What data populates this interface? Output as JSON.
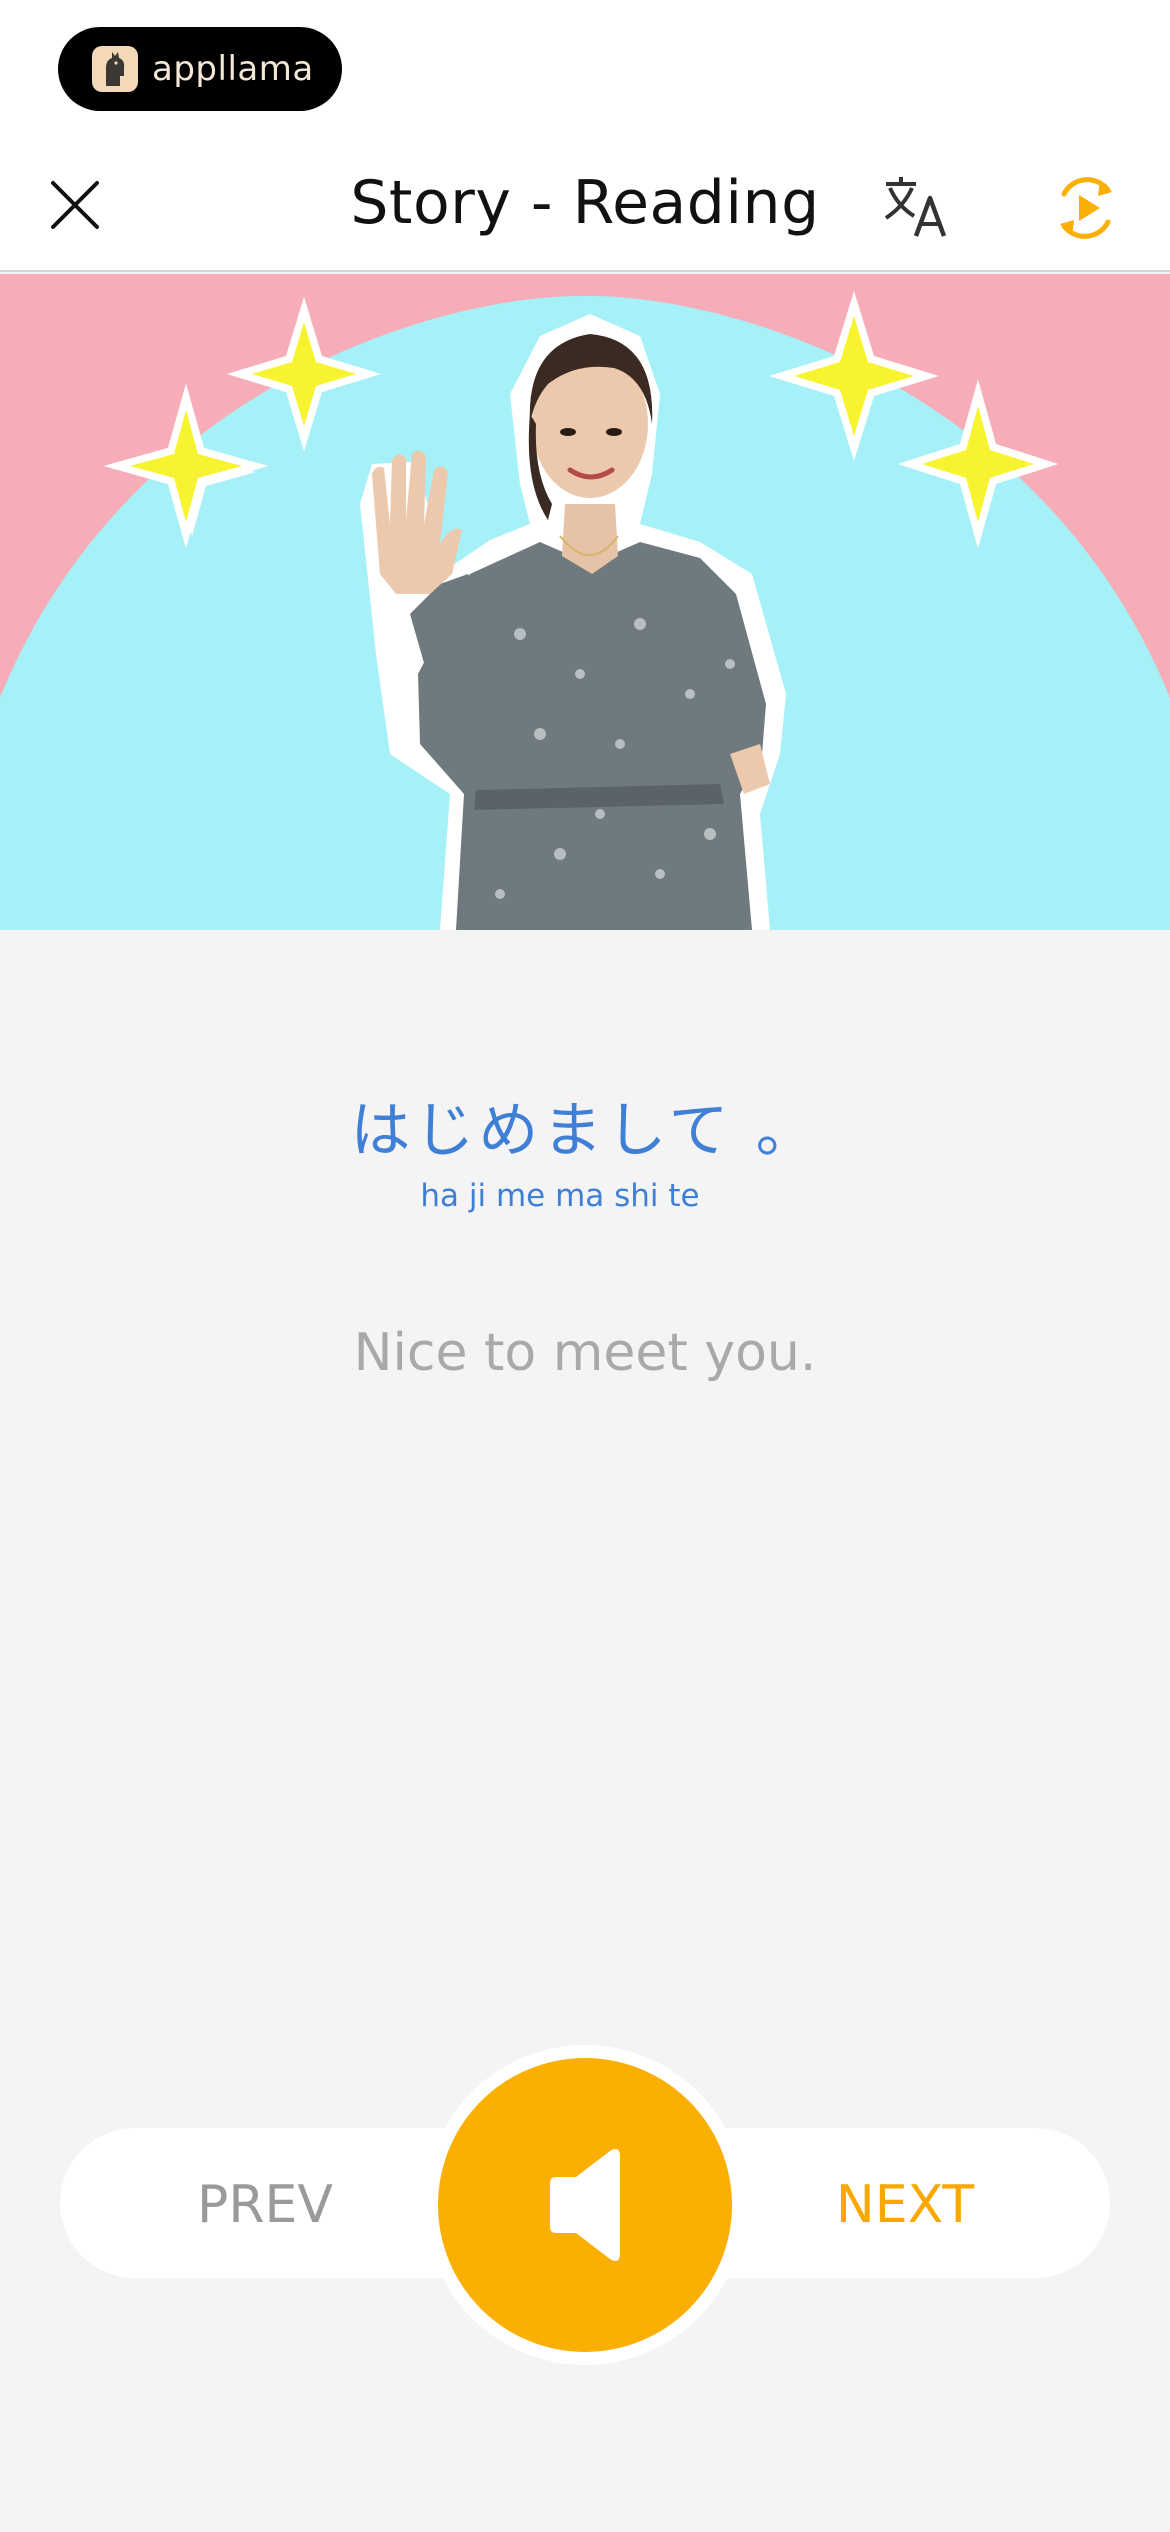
{
  "brand": {
    "name": "appllama"
  },
  "header": {
    "title": "Story - Reading",
    "close_icon": "close-icon",
    "translate_icon": "translate-icon",
    "autoplay_icon": "autoplay-icon"
  },
  "hero": {
    "image": "teacher-waving-with-sparkles"
  },
  "phrase": {
    "japanese": "はじめまして 。",
    "romaji": "ha ji me ma shi te",
    "translation": "Nice to meet you."
  },
  "controls": {
    "prev_label": "PREV",
    "next_label": "NEXT",
    "audio_icon": "speaker-icon"
  },
  "colors": {
    "accent": "#fbaf03",
    "next_text": "#f8a800",
    "phrase_blue": "#3f7fd6",
    "hero_pink": "#f7adb8",
    "hero_cyan": "#a6f1f8"
  }
}
